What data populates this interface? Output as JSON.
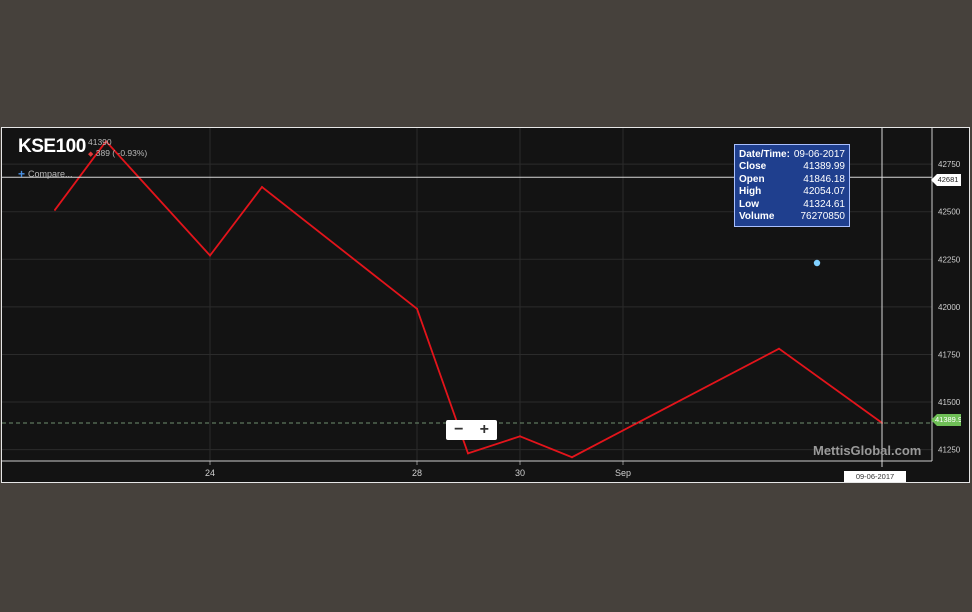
{
  "header": {
    "symbol": "KSE100",
    "last": "41390",
    "change": "389 ( -0.93%)",
    "compare_label": "Compare..."
  },
  "tooltip": {
    "rows": [
      {
        "label": "Date/Time:",
        "value": "09-06-2017"
      },
      {
        "label": "Close",
        "value": "41389.99"
      },
      {
        "label": "Open",
        "value": "41846.18"
      },
      {
        "label": "High",
        "value": "42054.07"
      },
      {
        "label": "Low",
        "value": "41324.61"
      },
      {
        "label": "Volume",
        "value": "76270850"
      }
    ]
  },
  "crosshair": {
    "price_label": "42681",
    "date_label": "09-06-2017"
  },
  "last_price_label": "41389.99",
  "zoom": {
    "minus": "−",
    "plus": "+"
  },
  "watermark": "MettisGlobal.com",
  "colors": {
    "line": "#e3141b",
    "background": "#131313",
    "last_price": "#6fbf57",
    "tooltip": "#1f3f8e"
  },
  "chart_data": {
    "type": "line",
    "title": "KSE100",
    "x": [
      "08-21-2017",
      "08-22-2017",
      "08-24-2017",
      "08-25-2017",
      "08-28-2017",
      "08-29-2017",
      "08-30-2017",
      "08-31-2017",
      "09-04-2017",
      "09-06-2017"
    ],
    "x_ticks": [
      "24",
      "28",
      "30",
      "Sep"
    ],
    "series": [
      {
        "values": [
          42510,
          42870,
          42270,
          42630,
          41990,
          41230,
          41320,
          41210,
          41780,
          41390
        ]
      }
    ],
    "y_ticks": [
      41250,
      41500,
      41750,
      42000,
      42250,
      42500,
      42750
    ],
    "ylim": [
      41190,
      42940
    ],
    "grid": true
  }
}
